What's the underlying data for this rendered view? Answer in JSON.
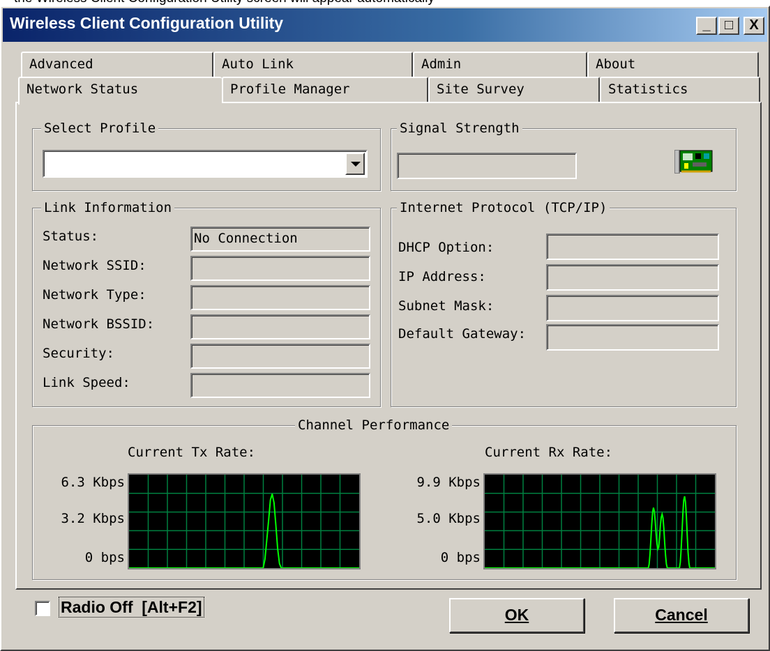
{
  "top_strip_text": "the Wireless Client Configuration Utility screen will appear automatically",
  "window": {
    "title": "Wireless Client Configuration Utility",
    "minimize": "_",
    "maximize": "□",
    "close": "X"
  },
  "tabs": {
    "back_row": [
      "Advanced",
      "Auto Link",
      "Admin",
      "About"
    ],
    "front_row": [
      "Network Status",
      "Profile Manager",
      "Site Survey",
      "Statistics"
    ],
    "active": "Network Status"
  },
  "select_profile": {
    "legend": "Select Profile",
    "value": ""
  },
  "signal_strength": {
    "legend": "Signal Strength",
    "level": 0,
    "icon": "network-card-icon"
  },
  "link_information": {
    "legend": "Link Information",
    "rows": [
      {
        "label": "Status:",
        "value": "No Connection"
      },
      {
        "label": "Network SSID:",
        "value": ""
      },
      {
        "label": "Network Type:",
        "value": ""
      },
      {
        "label": "Network BSSID:",
        "value": ""
      },
      {
        "label": "Security:",
        "value": ""
      },
      {
        "label": "Link Speed:",
        "value": ""
      }
    ]
  },
  "tcpip": {
    "legend": "Internet Protocol (TCP/IP)",
    "rows": [
      {
        "label": "DHCP Option:",
        "value": ""
      },
      {
        "label": "IP Address:",
        "value": ""
      },
      {
        "label": "Subnet Mask:",
        "value": ""
      },
      {
        "label": "Default Gateway:",
        "value": ""
      }
    ]
  },
  "channel_performance": {
    "legend": "Channel Performance",
    "tx": {
      "title": "Current Tx Rate:",
      "top": "6.3 Kbps",
      "mid": "3.2 Kbps",
      "bottom": "0 bps"
    },
    "rx": {
      "title": "Current Rx Rate:",
      "top": "9.9 Kbps",
      "mid": "5.0 Kbps",
      "bottom": "0 bps"
    }
  },
  "chart_data": [
    {
      "type": "line",
      "title": "Current Tx Rate:",
      "unit": "Kbps",
      "ylim": [
        0,
        6.3
      ],
      "yticks": [
        "0 bps",
        "3.2 Kbps",
        "6.3 Kbps"
      ],
      "grid": true,
      "series": [
        {
          "color": "#00ff00",
          "values": [
            0,
            0,
            0,
            0,
            0,
            0,
            0,
            0,
            0,
            0,
            0,
            0,
            0,
            0,
            0,
            0,
            0,
            0,
            0,
            0,
            0,
            0,
            0,
            0,
            0,
            0,
            0,
            0,
            0,
            0,
            0,
            0,
            0,
            0,
            0,
            0,
            0,
            0,
            0,
            0,
            0,
            0,
            0,
            0,
            0,
            0,
            0,
            0,
            0,
            0,
            0,
            0,
            0,
            0,
            0,
            0,
            0,
            0,
            0,
            0,
            0,
            0,
            0,
            0,
            0,
            0,
            0,
            0,
            0,
            0,
            0,
            0,
            0,
            0,
            0,
            0.6,
            1.9,
            3.2,
            4.6,
            5.0,
            4.4,
            2.9,
            1.3,
            0.3,
            0,
            0,
            0,
            0,
            0,
            0,
            0,
            0,
            0,
            0,
            0,
            0,
            0,
            0,
            0,
            0,
            0,
            0,
            0,
            0,
            0,
            0,
            0,
            0,
            0,
            0,
            0,
            0,
            0,
            0,
            0,
            0,
            0,
            0,
            0,
            0,
            0,
            0,
            0,
            0,
            0,
            0,
            0,
            0
          ]
        }
      ]
    },
    {
      "type": "line",
      "title": "Current Rx Rate:",
      "unit": "Kbps",
      "ylim": [
        0,
        9.9
      ],
      "yticks": [
        "0 bps",
        "5.0 Kbps",
        "9.9 Kbps"
      ],
      "grid": true,
      "series": [
        {
          "color": "#00ff00",
          "values": [
            0,
            0,
            0,
            0,
            0,
            0,
            0,
            0,
            0,
            0,
            0,
            0,
            0,
            0,
            0,
            0,
            0,
            0,
            0,
            0,
            0,
            0,
            0,
            0,
            0,
            0,
            0,
            0,
            0,
            0,
            0,
            0,
            0,
            0,
            0,
            0,
            0,
            0,
            0,
            0,
            0,
            0,
            0,
            0,
            0,
            0,
            0,
            0,
            0,
            0,
            0,
            0,
            0,
            0,
            0,
            0,
            0,
            0,
            0,
            0,
            0,
            0,
            0,
            0,
            0,
            0,
            0,
            0,
            0,
            0,
            0,
            0,
            0,
            0,
            0,
            0,
            0,
            0,
            0,
            0,
            0,
            0,
            0,
            0,
            0,
            0,
            0,
            0,
            0,
            0,
            0,
            0,
            0,
            0,
            0,
            0,
            0,
            0,
            0,
            0,
            0,
            0,
            0,
            0,
            0,
            0,
            0,
            0,
            0,
            0,
            0,
            0,
            0,
            0,
            0,
            0,
            0,
            0,
            0,
            0,
            0,
            0,
            0,
            0,
            0,
            0,
            0,
            0,
            0,
            0,
            0,
            0,
            0,
            0,
            0,
            0,
            0,
            0,
            0,
            0,
            0,
            0,
            0,
            0,
            0,
            0,
            0,
            0,
            0,
            0,
            0,
            0,
            0,
            0,
            0,
            0,
            0,
            0,
            0,
            0,
            0,
            0,
            0,
            0,
            0,
            0,
            0,
            0,
            0,
            0,
            0,
            0,
            0,
            0,
            0,
            0,
            0,
            0,
            0,
            0,
            0,
            0,
            0,
            0,
            0,
            0,
            0,
            0,
            0,
            0,
            0.4,
            1.5,
            3.0,
            4.6,
            5.9,
            6.4,
            6.0,
            5.0,
            3.7,
            2.6,
            2.0,
            2.2,
            3.2,
            4.5,
            5.4,
            5.7,
            5.3,
            4.2,
            2.7,
            1.3,
            0.4,
            0,
            0,
            0,
            0,
            0,
            0,
            0,
            0,
            0,
            0,
            0,
            0,
            0,
            0,
            0,
            0.6,
            2.0,
            3.9,
            5.8,
            7.2,
            7.6,
            7.0,
            5.5,
            3.5,
            1.7,
            0.5,
            0,
            0,
            0,
            0,
            0,
            0,
            0,
            0,
            0,
            0,
            0,
            0,
            0,
            0,
            0,
            0,
            0,
            0,
            0,
            0,
            0,
            0,
            0,
            0,
            0,
            0,
            0,
            0,
            0,
            0
          ]
        }
      ]
    }
  ],
  "radio_off": {
    "label": "Radio Off  [Alt+F2]",
    "checked": false
  },
  "buttons": {
    "ok": "OK",
    "cancel": "Cancel"
  }
}
